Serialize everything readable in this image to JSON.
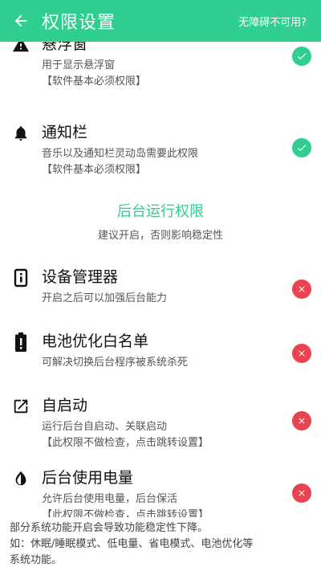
{
  "header": {
    "title": "权限设置",
    "action": "无障碍不可用?",
    "back_icon": "arrow-left-icon",
    "color": "#2ecf8f"
  },
  "permissions_basic": [
    {
      "icon": "warning-icon",
      "title": "悬浮窗",
      "desc": "用于显示悬浮窗",
      "note": "【软件基本必须权限】",
      "status": "ok"
    },
    {
      "icon": "bell-icon",
      "title": "通知栏",
      "desc": "音乐以及通知栏灵动岛需要此权限",
      "note": "【软件基本必须权限】",
      "status": "ok"
    }
  ],
  "section": {
    "title": "后台运行权限",
    "subtitle": "建议开启，否则影响稳定性"
  },
  "permissions_background": [
    {
      "icon": "device-admin-icon",
      "title": "设备管理器",
      "desc": "开启之后可以加强后台能力",
      "note": "",
      "status": "bad"
    },
    {
      "icon": "battery-alert-icon",
      "title": "电池优化白名单",
      "desc": "可解决切换后台程序被系统杀死",
      "note": "",
      "status": "bad"
    },
    {
      "icon": "open-external-icon",
      "title": "自启动",
      "desc": "运行后台自启动、关联启动",
      "note": "【此权限不做检查，点击跳转设置】",
      "status": "bad"
    },
    {
      "icon": "half-drop-icon",
      "title": "后台使用电量",
      "desc": "允许后台使用电量，后台保活",
      "note": "【此权限不做检查，点击跳转设置】",
      "status": "bad"
    }
  ],
  "footer": {
    "line1": "部分系统功能开启会导致功能稳定性下降。",
    "line2": "如：休眠/睡眠模式、低电量、省电模式、电池优化等",
    "line3": "系统功能。"
  },
  "colors": {
    "ok": "#2ecf8f",
    "bad": "#e8444f"
  }
}
